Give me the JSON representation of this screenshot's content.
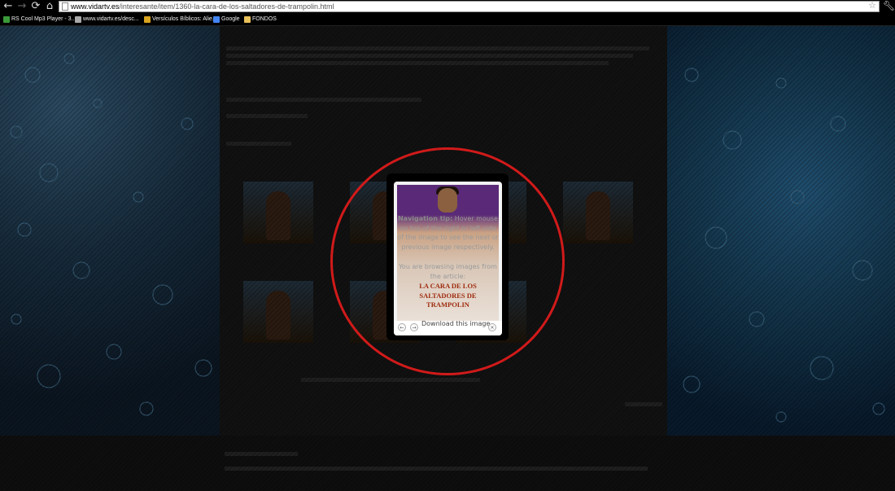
{
  "browser": {
    "url_domain": "www.vidartv.es",
    "url_path": "/interesante/item/1360-la-cara-de-los-saltadores-de-trampolin.html",
    "nav_icons": [
      "back-icon",
      "forward-icon",
      "reload-icon",
      "home-icon"
    ]
  },
  "bookmarks": [
    {
      "label": "RS Cool Mp3 Player - 3...",
      "color": "#3a9a3a"
    },
    {
      "label": "www.vidartv.es/desc...",
      "color": "#aaaaaa"
    },
    {
      "label": "Versículos Bíblicos: Alie...",
      "color": "#d9a520"
    },
    {
      "label": "Google",
      "color": "#4285f4"
    },
    {
      "label": "FONDOS",
      "color": "#e8c15a"
    }
  ],
  "lightbox": {
    "tip_label": "Navigation tip:",
    "tip_text": "Hover mouse on top of the right or left side of the image to see the next or previous image respectively.",
    "browsing_text": "You are browsing images from the article:",
    "article_title": "LA CARA DE LOS SALTADORES DE TRAMPOLIN",
    "download_label": "Download this image",
    "prev_glyph": "←",
    "next_glyph": "→",
    "close_glyph": "×"
  },
  "colors": {
    "highlight_ring": "#d11a1a",
    "article_title": "#9e2b0e"
  }
}
